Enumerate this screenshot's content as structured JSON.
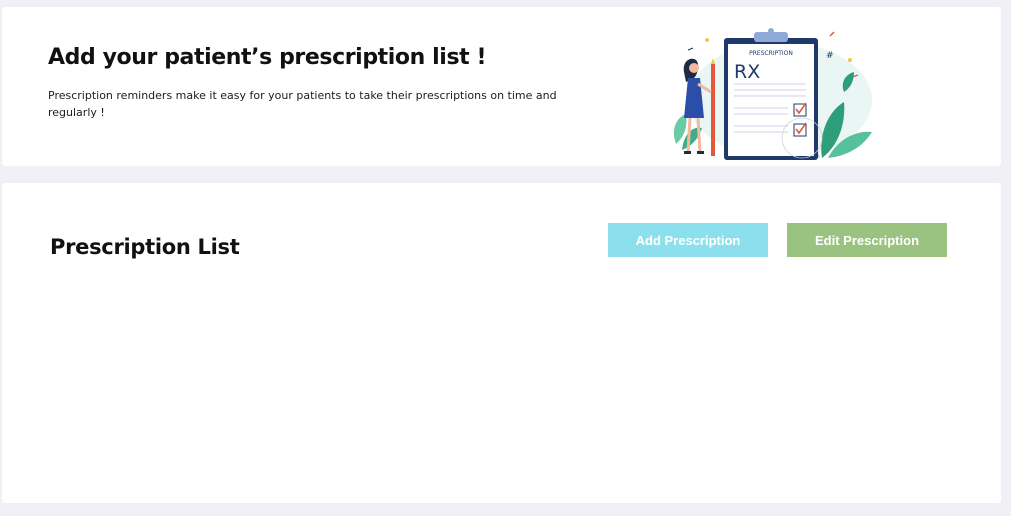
{
  "hero": {
    "title": "Add your patient’s prescription list !",
    "description": "Prescription reminders make it easy for your patients to take their prescriptions on time and regularly !",
    "illustration": {
      "clipboard_heading": "PRESCRIPTION",
      "clipboard_rx": "RX"
    }
  },
  "prescription_list": {
    "title": "Prescription List",
    "add_button_label": "Add Prescription",
    "edit_button_label": "Edit Prescription"
  },
  "colors": {
    "page_background": "#f0f0f7",
    "card_background": "#ffffff",
    "add_button": "#8ce0ee",
    "edit_button": "#9ac382",
    "clipboard_navy": "#1f3a68",
    "check_red": "#e4573a",
    "leaf_green": "#2e9e7a"
  }
}
